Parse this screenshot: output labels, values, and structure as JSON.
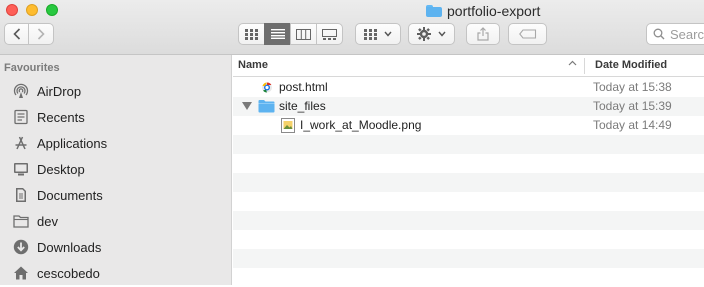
{
  "window": {
    "title": "portfolio-export",
    "title_icon": "folder-icon"
  },
  "toolbar": {
    "back": "‹",
    "forward": "›",
    "views": [
      "icon-view",
      "list-view",
      "column-view",
      "gallery-view"
    ],
    "active_view": "list-view",
    "search_placeholder": "Search"
  },
  "sidebar": {
    "heading": "Favourites",
    "items": [
      {
        "label": "AirDrop",
        "icon": "airdrop-icon"
      },
      {
        "label": "Recents",
        "icon": "recents-icon"
      },
      {
        "label": "Applications",
        "icon": "applications-icon"
      },
      {
        "label": "Desktop",
        "icon": "desktop-icon"
      },
      {
        "label": "Documents",
        "icon": "documents-icon"
      },
      {
        "label": "dev",
        "icon": "folder-icon"
      },
      {
        "label": "Downloads",
        "icon": "downloads-icon"
      },
      {
        "label": "cescobedo",
        "icon": "home-icon"
      }
    ]
  },
  "columns": {
    "name": "Name",
    "date": "Date Modified"
  },
  "files": [
    {
      "name": "post.html",
      "date": "Today at 15:38",
      "icon": "html-file-icon"
    },
    {
      "name": "site_files",
      "date": "Today at 15:39",
      "icon": "folder-icon",
      "expanded": true
    },
    {
      "name": "I_work_at_Moodle.png",
      "date": "Today at 14:49",
      "icon": "image-file-icon"
    }
  ]
}
